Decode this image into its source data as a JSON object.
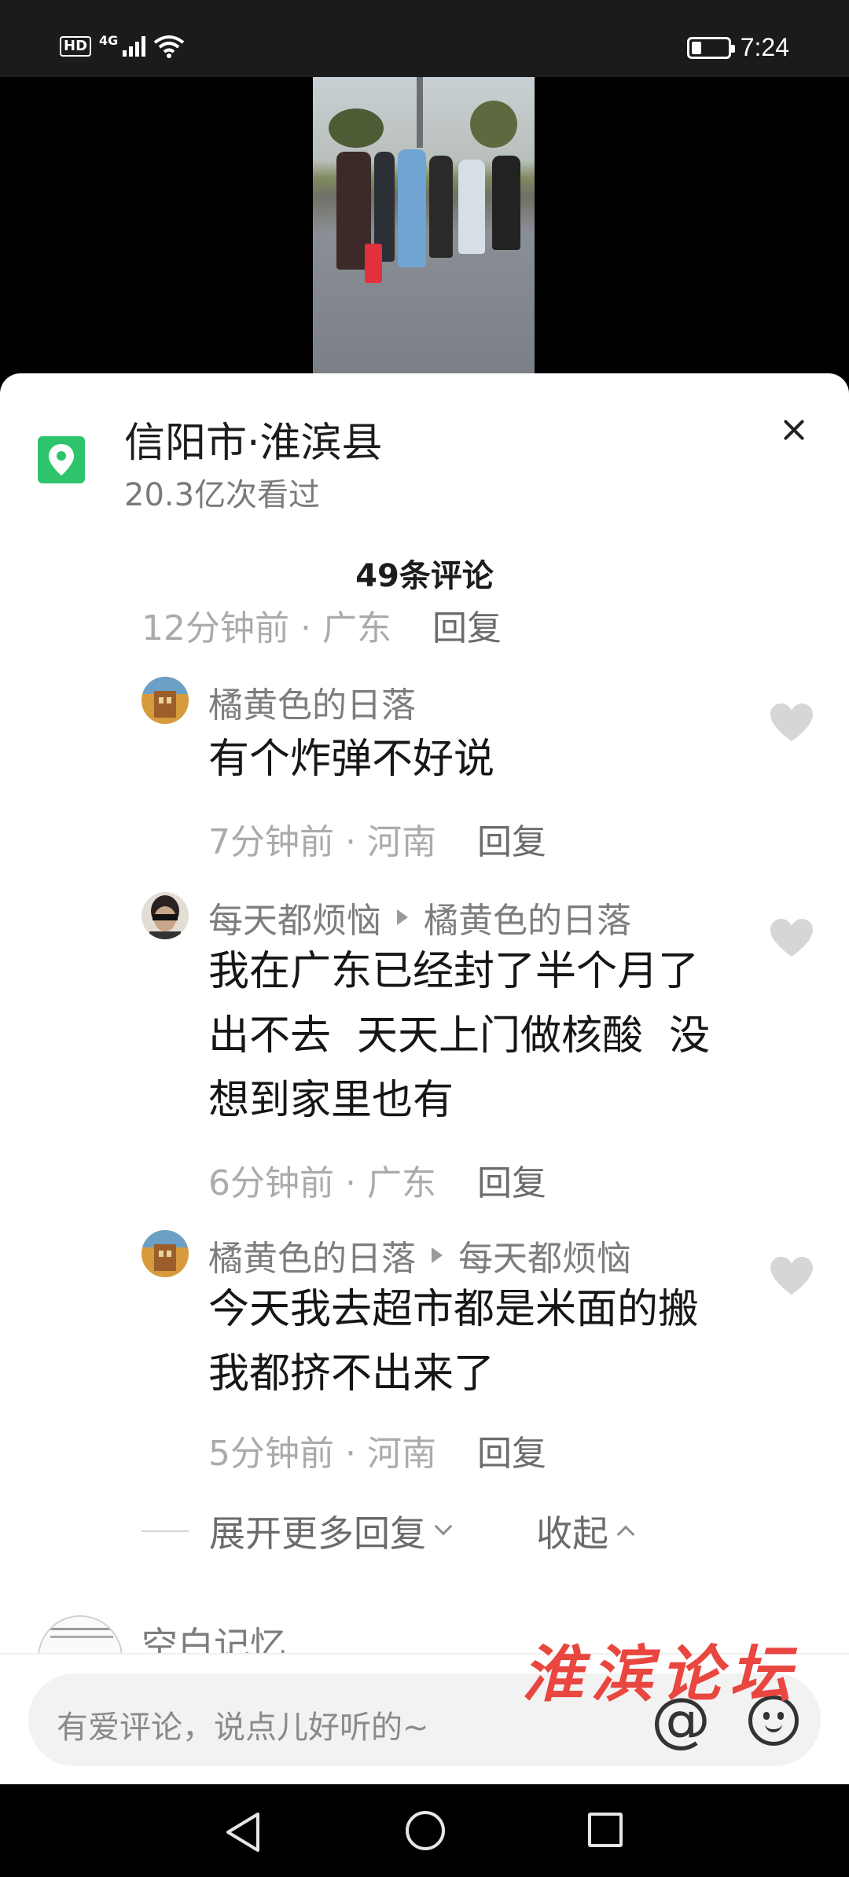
{
  "status_bar": {
    "hd": "HD",
    "network": "4G",
    "battery_level": 0.25,
    "time": "7:24"
  },
  "location": {
    "title": "信阳市·淮滨县",
    "views": "20.3亿次看过",
    "icon": "location-pin-icon"
  },
  "comments_header": "49条评论",
  "parent_meta": {
    "time_place": "12分钟前 · 广东",
    "reply": "回复"
  },
  "replies": [
    {
      "author": "橘黄色的日落",
      "reply_to": "",
      "text": "有个炸弹不好说",
      "time_place": "7分钟前 · 河南",
      "reply": "回复"
    },
    {
      "author": "每天都烦恼",
      "reply_to": "橘黄色的日落",
      "text_lines": [
        "我在广东已经封了半个月了",
        "出不去  天天上门做核酸  没",
        "想到家里也有"
      ],
      "time_place": "6分钟前 · 广东",
      "reply": "回复"
    },
    {
      "author": "橘黄色的日落",
      "reply_to": "每天都烦恼",
      "text_lines": [
        "今天我去超市都是米面的搬",
        "我都挤不出来了"
      ],
      "time_place": "5分钟前 · 河南",
      "reply": "回复"
    }
  ],
  "expand": {
    "more": "展开更多回复",
    "collapse": "收起"
  },
  "next_comment": {
    "author": "空白记忆"
  },
  "input": {
    "placeholder": "有爱评论，说点儿好听的~",
    "at": "@"
  },
  "watermark": "淮滨论坛",
  "colors": {
    "accent_green": "#2ec46b",
    "watermark_red": "#e8463f"
  }
}
